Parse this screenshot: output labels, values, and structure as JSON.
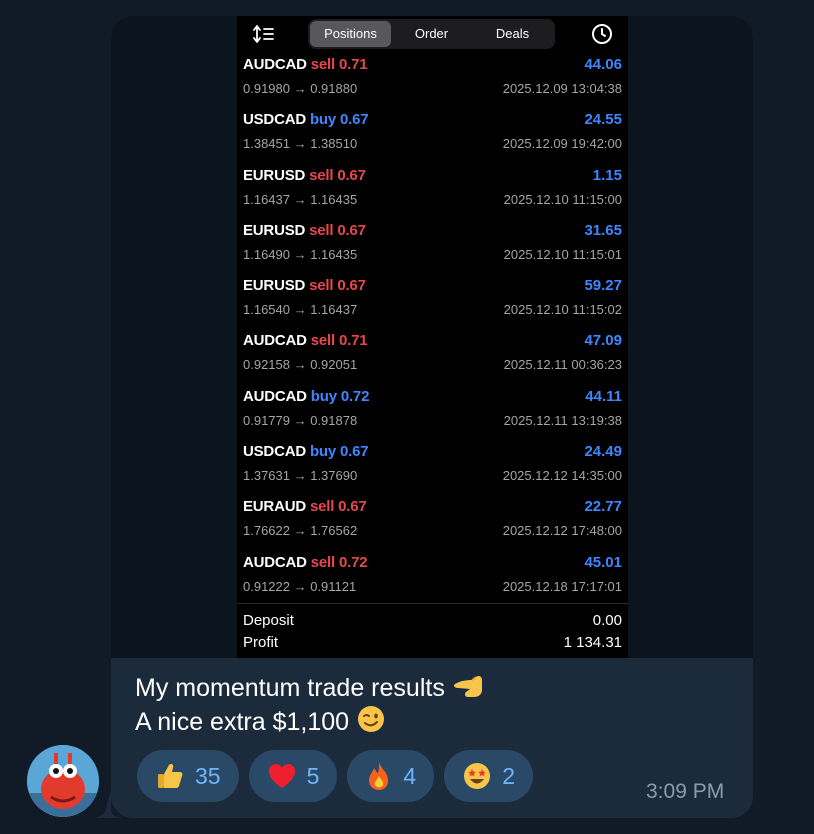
{
  "tabs": {
    "positions": "Positions",
    "order": "Order",
    "deals": "Deals"
  },
  "deals": [
    {
      "symbol": "AUDCAD",
      "direction": "sell",
      "volume": "0.71",
      "profit": "44.06",
      "prices": "0.91980 → 0.91880",
      "time": "2025.12.09 13:04:38"
    },
    {
      "symbol": "USDCAD",
      "direction": "buy",
      "volume": "0.67",
      "profit": "24.55",
      "prices": "1.38451 → 1.38510",
      "time": "2025.12.09 19:42:00"
    },
    {
      "symbol": "EURUSD",
      "direction": "sell",
      "volume": "0.67",
      "profit": "1.15",
      "prices": "1.16437 → 1.16435",
      "time": "2025.12.10 11:15:00"
    },
    {
      "symbol": "EURUSD",
      "direction": "sell",
      "volume": "0.67",
      "profit": "31.65",
      "prices": "1.16490 → 1.16435",
      "time": "2025.12.10 11:15:01"
    },
    {
      "symbol": "EURUSD",
      "direction": "sell",
      "volume": "0.67",
      "profit": "59.27",
      "prices": "1.16540 → 1.16437",
      "time": "2025.12.10 11:15:02"
    },
    {
      "symbol": "AUDCAD",
      "direction": "sell",
      "volume": "0.71",
      "profit": "47.09",
      "prices": "0.92158 → 0.92051",
      "time": "2025.12.11 00:36:23"
    },
    {
      "symbol": "AUDCAD",
      "direction": "buy",
      "volume": "0.72",
      "profit": "44.11",
      "prices": "0.91779 → 0.91878",
      "time": "2025.12.11 13:19:38"
    },
    {
      "symbol": "USDCAD",
      "direction": "buy",
      "volume": "0.67",
      "profit": "24.49",
      "prices": "1.37631 → 1.37690",
      "time": "2025.12.12 14:35:00"
    },
    {
      "symbol": "EURAUD",
      "direction": "sell",
      "volume": "0.67",
      "profit": "22.77",
      "prices": "1.76622 → 1.76562",
      "time": "2025.12.12 17:48:00"
    },
    {
      "symbol": "AUDCAD",
      "direction": "sell",
      "volume": "0.72",
      "profit": "45.01",
      "prices": "0.91222 → 0.91121",
      "time": "2025.12.18 17:17:01"
    }
  ],
  "summary": {
    "deposit_label": "Deposit",
    "deposit_value": "0.00",
    "profit_label": "Profit",
    "profit_value": "1 134.31"
  },
  "message": {
    "line1": "My momentum trade results",
    "line2": "A nice extra $1,100",
    "time": "3:09 PM"
  },
  "reactions": [
    {
      "icon": "thumbs-up-icon",
      "count": "35"
    },
    {
      "icon": "heart-icon",
      "count": "5"
    },
    {
      "icon": "fire-icon",
      "count": "4"
    },
    {
      "icon": "star-struck-icon",
      "count": "2"
    }
  ],
  "colors": {
    "sell": "#e5484d",
    "buy": "#3f86ff",
    "reaction_bg": "#2a4966",
    "bubble_bg": "#1c2b3b"
  }
}
